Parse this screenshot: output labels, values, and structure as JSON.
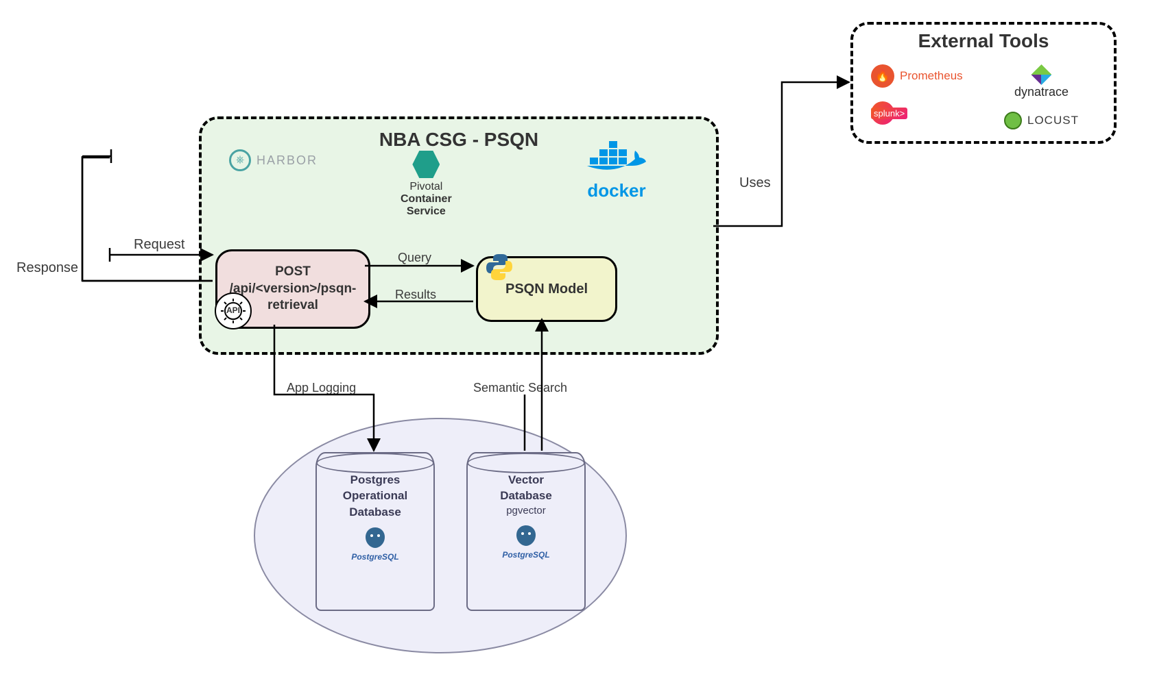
{
  "main_group": {
    "title": "NBA CSG - PSQN",
    "harbor_label": "HARBOR",
    "pivotal_lines": [
      "Pivotal",
      "Container",
      "Service"
    ],
    "docker_label": "docker"
  },
  "api_box": {
    "method": "POST",
    "path": "/api/<version>/psqn-retrieval",
    "gear_label": "API"
  },
  "model_box": {
    "label": "PSQN Model"
  },
  "edges": {
    "request": "Request",
    "response": "Response",
    "query": "Query",
    "results": "Results",
    "uses": "Uses",
    "app_logging": "App Logging",
    "semantic_search": "Semantic Search"
  },
  "db_group": {
    "left": {
      "line1": "Postgres",
      "line2": "Operational",
      "line3": "Database",
      "engine": "PostgreSQL"
    },
    "right": {
      "line1": "Vector",
      "line2": "Database",
      "sub": "pgvector",
      "engine": "PostgreSQL"
    }
  },
  "external": {
    "title": "External Tools",
    "prometheus": "Prometheus",
    "splunk": "splunk>",
    "dynatrace": "dynatrace",
    "locust": "LOCUST"
  }
}
